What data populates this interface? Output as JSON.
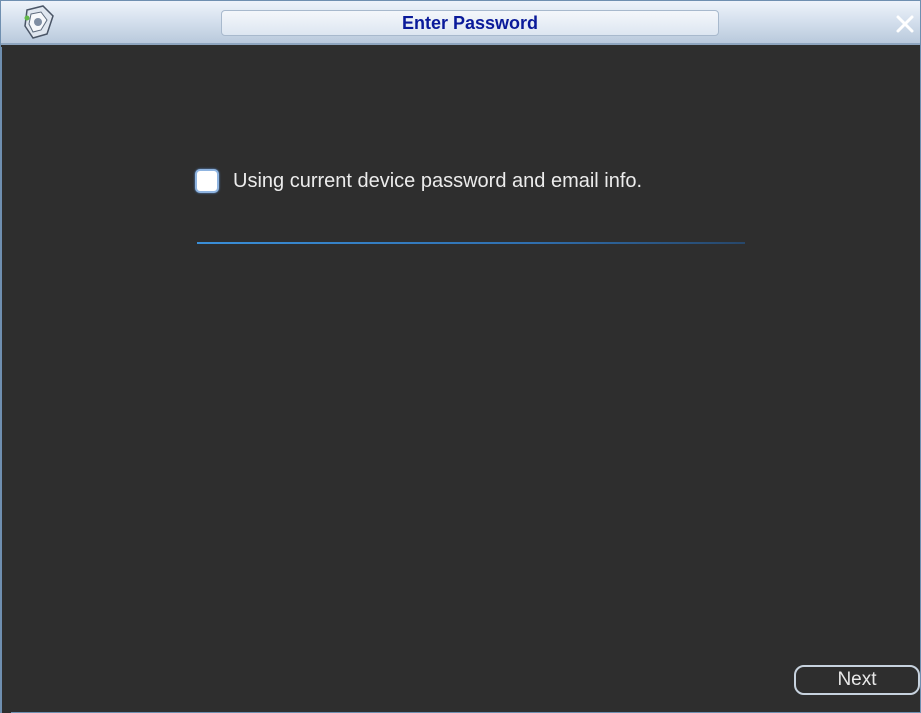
{
  "window": {
    "title": "Enter Password",
    "app_icon": "app-logo-icon",
    "close_icon": "close-icon"
  },
  "content": {
    "checkbox_label": "Using current device password and email info.",
    "checkbox_checked": false
  },
  "footer": {
    "next_label": "Next"
  },
  "colors": {
    "background": "#2e2e2e",
    "title_text": "#0a1a9a",
    "divider_accent": "#3a8fd8",
    "text": "#ececec"
  }
}
